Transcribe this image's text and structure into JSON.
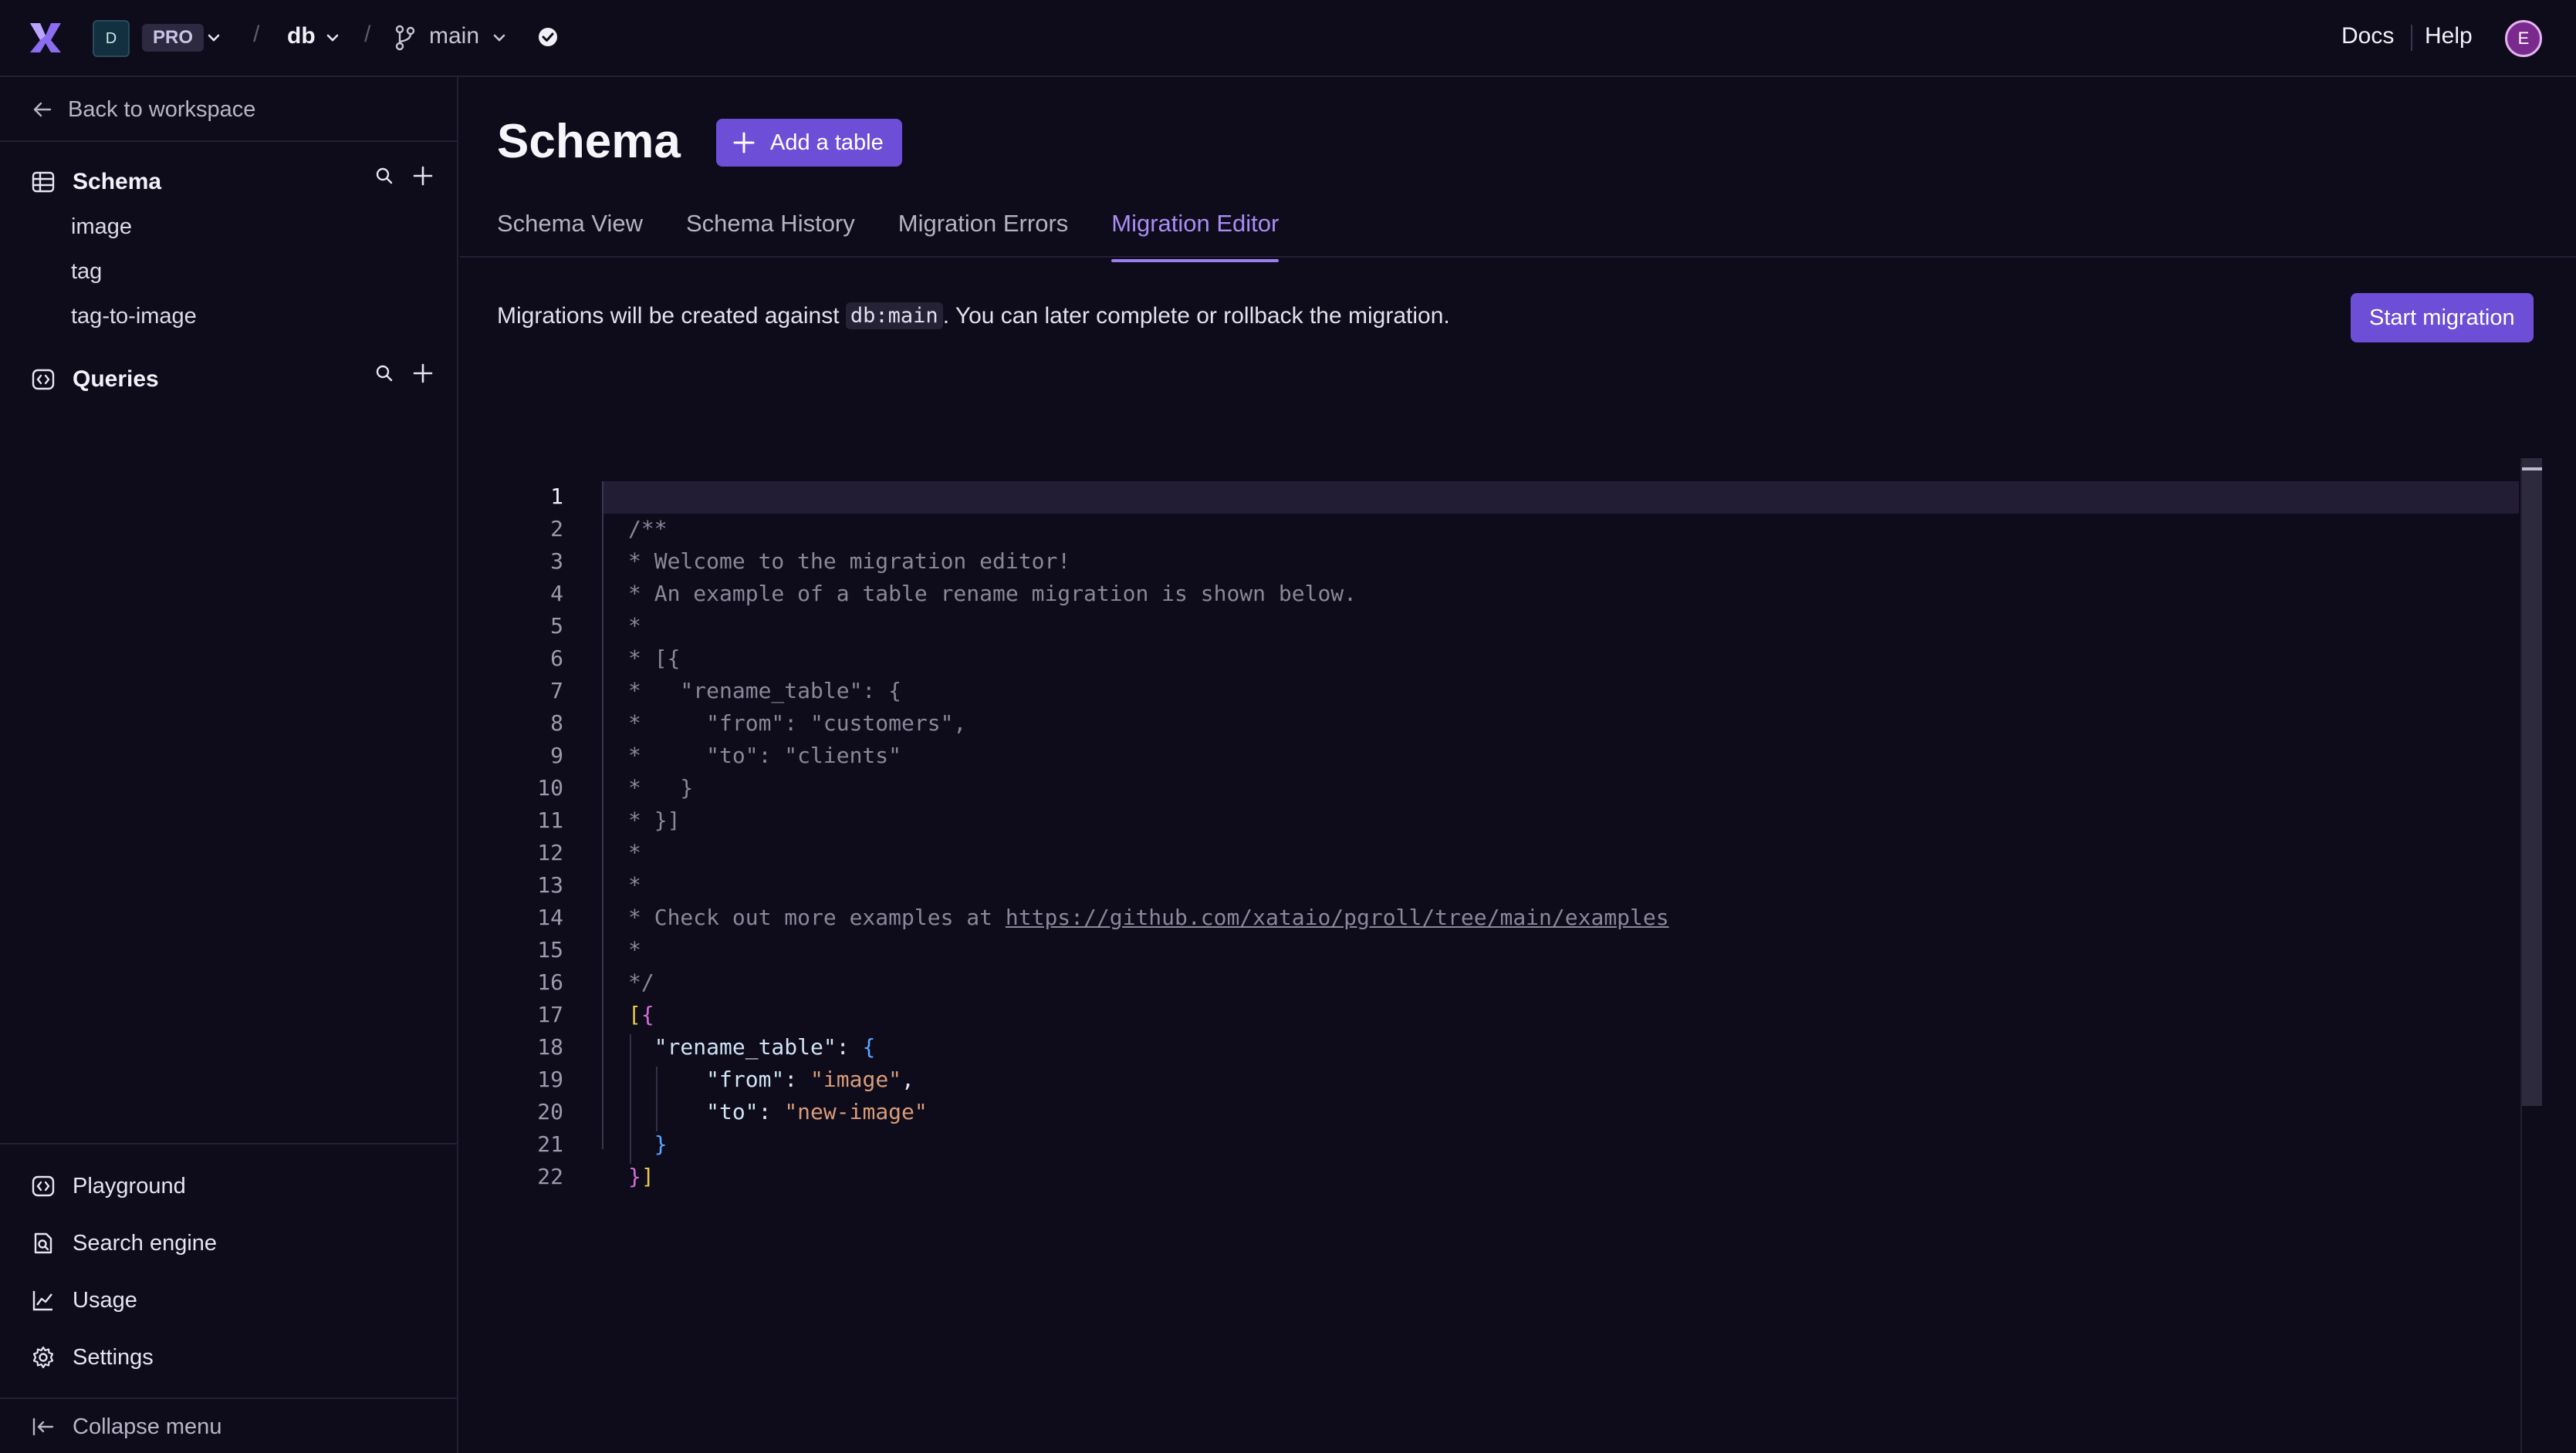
{
  "topbar": {
    "workspace_initial": "D",
    "plan_badge": "PRO",
    "database": "db",
    "branch": "main",
    "separator": "/",
    "docs_label": "Docs",
    "help_label": "Help",
    "avatar_initial": "E"
  },
  "sidebar": {
    "back_label": "Back to workspace",
    "schema_label": "Schema",
    "tables": [
      "image",
      "tag",
      "tag-to-image"
    ],
    "queries_label": "Queries",
    "bottom_items": [
      {
        "label": "Playground",
        "icon": "playground-icon"
      },
      {
        "label": "Search engine",
        "icon": "search-engine-icon"
      },
      {
        "label": "Usage",
        "icon": "usage-chart-icon"
      },
      {
        "label": "Settings",
        "icon": "gear-icon"
      }
    ],
    "collapse_label": "Collapse menu"
  },
  "main": {
    "title": "Schema",
    "add_table_label": "Add a table",
    "tabs": [
      {
        "label": "Schema View",
        "active": false
      },
      {
        "label": "Schema History",
        "active": false
      },
      {
        "label": "Migration Errors",
        "active": false
      },
      {
        "label": "Migration Editor",
        "active": true
      }
    ],
    "notice_prefix": "Migrations will be created against ",
    "notice_code": "db:main",
    "notice_suffix": ". You can later complete or rollback the migration.",
    "start_migration_label": "Start migration"
  },
  "editor": {
    "line_numbers": [
      "1",
      "2",
      "3",
      "4",
      "5",
      "6",
      "7",
      "8",
      "9",
      "10",
      "11",
      "12",
      "13",
      "14",
      "15",
      "16",
      "17",
      "18",
      "19",
      "20",
      "21",
      "22"
    ],
    "active_line": 1,
    "comment_lines": [
      "/**",
      "* Welcome to the migration editor!",
      "* An example of a table rename migration is shown below.",
      "*",
      "* [{",
      "*   \"rename_table\": {",
      "*     \"from\": \"customers\",",
      "*     \"to\": \"clients\"",
      "*   }",
      "* }]",
      "*",
      "*"
    ],
    "link_prefix": "* Check out more examples at ",
    "link_url": "https://github.com/xataio/pgroll/tree/main/examples",
    "comment_tail": [
      "*",
      "*/"
    ],
    "code": {
      "open": "[{",
      "key_rename": "\"rename_table\"",
      "colon": ": ",
      "brace_open": "{",
      "key_from": "\"from\"",
      "val_from": "\"image\"",
      "comma": ",",
      "key_to": "\"to\"",
      "val_to": "\"new-image\"",
      "brace_close": "}",
      "close": "}]"
    }
  },
  "colors": {
    "background": "#0e0b1a",
    "accent": "#6c4fd6",
    "active_tab": "#a98df5"
  }
}
